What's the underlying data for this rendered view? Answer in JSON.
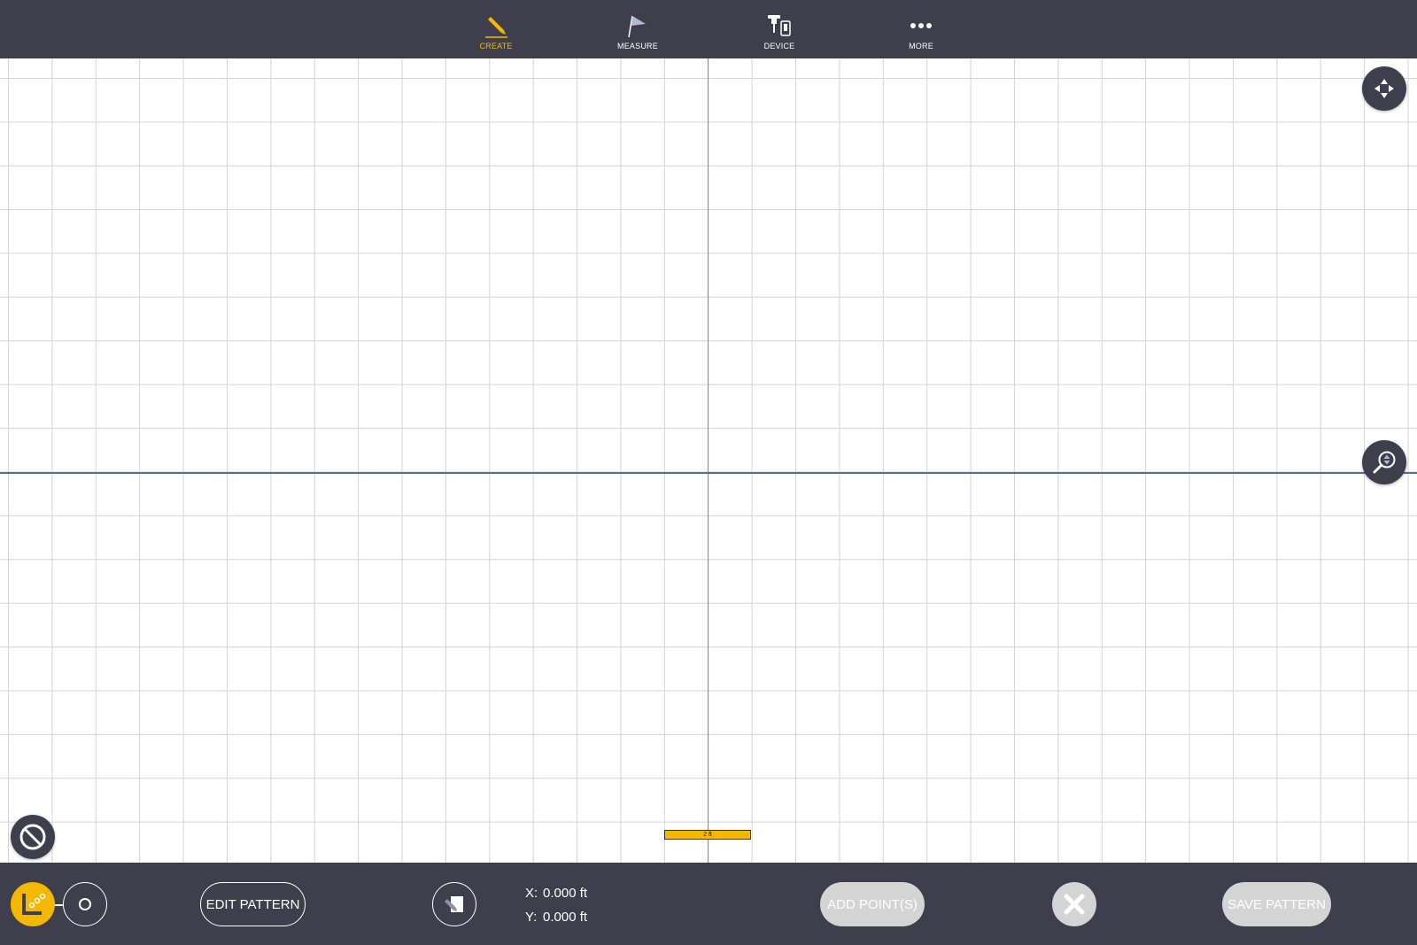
{
  "nav": {
    "items": [
      {
        "label": "CREATE",
        "icon": "pencil-icon",
        "active": true
      },
      {
        "label": "MEASURE",
        "icon": "flag-icon",
        "active": false
      },
      {
        "label": "DEVICE",
        "icon": "device-icon",
        "active": false
      },
      {
        "label": "MORE",
        "icon": "more-dots-icon",
        "active": false
      }
    ]
  },
  "canvas": {
    "scale_bar_label": "2 ft"
  },
  "bottom": {
    "edit_pattern_label": "EDIT PATTERN",
    "x_label": "X:",
    "x_value": "0.000 ft",
    "y_label": "Y:",
    "y_value": "0.000 ft",
    "add_points_label": "ADD POINT(S)",
    "save_pattern_label": "SAVE PATTERN"
  },
  "colors": {
    "toolbar_bg": "#3f3e4c",
    "accent": "#f5b800",
    "axis_horizontal": "#4a6fb0",
    "disabled_button": "#d4d4d4"
  }
}
